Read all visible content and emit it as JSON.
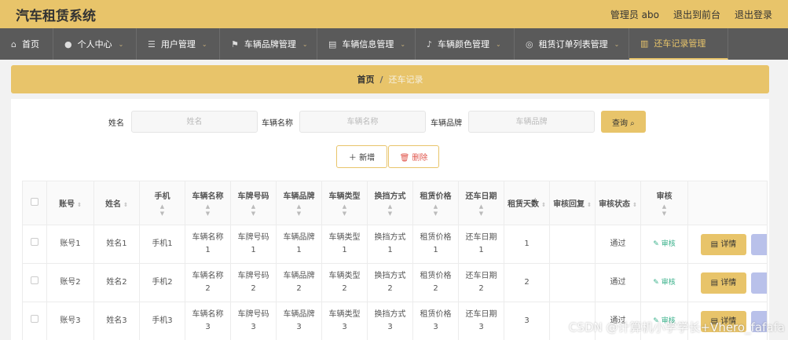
{
  "app": {
    "title": "汽车租赁系统",
    "admin": "管理员 abo",
    "to_front": "退出到前台",
    "logout": "退出登录"
  },
  "nav": [
    {
      "label": "首页",
      "icon": "home-icon",
      "glyph": "⌂",
      "dropdown": false,
      "active": false
    },
    {
      "label": "个人中心",
      "icon": "user-icon",
      "glyph": "●",
      "dropdown": true,
      "active": false
    },
    {
      "label": "用户管理",
      "icon": "list-icon",
      "glyph": "☰",
      "dropdown": true,
      "active": false
    },
    {
      "label": "车辆品牌管理",
      "icon": "flag-icon",
      "glyph": "⚑",
      "dropdown": true,
      "active": false
    },
    {
      "label": "车辆信息管理",
      "icon": "clipboard-icon",
      "glyph": "▤",
      "dropdown": true,
      "active": false
    },
    {
      "label": "车辆颜色管理",
      "icon": "bell-icon",
      "glyph": "♪",
      "dropdown": true,
      "active": false
    },
    {
      "label": "租赁订单列表管理",
      "icon": "compass-icon",
      "glyph": "◎",
      "dropdown": true,
      "active": false
    },
    {
      "label": "还车记录管理",
      "icon": "bar-chart-icon",
      "glyph": "▥",
      "dropdown": false,
      "active": true
    }
  ],
  "breadcrumb": {
    "home": "首页",
    "sep": "/",
    "current": "还车记录"
  },
  "search": {
    "name_label": "姓名",
    "name_placeholder": "姓名",
    "car_label": "车辆名称",
    "car_placeholder": "车辆名称",
    "brand_label": "车辆品牌",
    "brand_placeholder": "车辆品牌",
    "query": "查询 ⌕"
  },
  "actions": {
    "add": "＋ 新增",
    "delete": "🗑 删除"
  },
  "table": {
    "headers": [
      "账号",
      "姓名",
      "手机",
      "车辆名称",
      "车牌号码",
      "车辆品牌",
      "车辆类型",
      "换挡方式",
      "租赁价格",
      "还车日期",
      "租赁天数",
      "审核回复",
      "审核状态",
      "审核"
    ],
    "rows": [
      {
        "account": "账号1",
        "name": "姓名1",
        "phone": "手机1",
        "car_name": "车辆名称1",
        "plate": "车牌号码1",
        "brand": "车辆品牌1",
        "type": "车辆类型1",
        "gear": "换挡方式1",
        "price": "租赁价格1",
        "date": "还车日期1",
        "days": "1",
        "reply": "",
        "status": "通过",
        "audit": "审核",
        "detail": "详情"
      },
      {
        "account": "账号2",
        "name": "姓名2",
        "phone": "手机2",
        "car_name": "车辆名称2",
        "plate": "车牌号码2",
        "brand": "车辆品牌2",
        "type": "车辆类型2",
        "gear": "换挡方式2",
        "price": "租赁价格2",
        "date": "还车日期2",
        "days": "2",
        "reply": "",
        "status": "通过",
        "audit": "审核",
        "detail": "详情"
      },
      {
        "account": "账号3",
        "name": "姓名3",
        "phone": "手机3",
        "car_name": "车辆名称3",
        "plate": "车牌号码3",
        "brand": "车辆品牌3",
        "type": "车辆类型3",
        "gear": "换挡方式3",
        "price": "租赁价格3",
        "date": "还车日期3",
        "days": "3",
        "reply": "",
        "status": "通过",
        "audit": "审核",
        "detail": "详情"
      }
    ]
  },
  "watermark": "CSDN @计算机小学学长+Vhero_fafafa",
  "colors": {
    "accent": "#e8c46a",
    "nav_bg": "#5a5a5a",
    "approve_link": "#3cb28c",
    "delete": "#e0554b"
  }
}
